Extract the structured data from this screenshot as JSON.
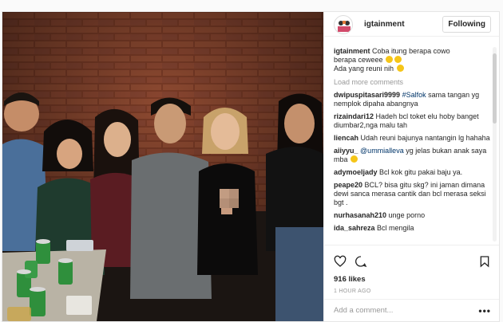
{
  "post": {
    "username": "igtainment",
    "follow_label": "Following",
    "caption": {
      "username": "igtainment",
      "line1": "Coba itung berapa cowo",
      "line2": "berapa ceweee",
      "line3": "Ada yang reuni nih"
    },
    "load_more_label": "Load more comments",
    "comments": [
      {
        "user": "dwipuspitasari9999",
        "hashtag": "#Salfok",
        "text": " sama tangan yg nemplok dipaha abangnya"
      },
      {
        "user": "rizaindari12",
        "text": "Hadeh bcl toket elu hoby banget diumbar2,nga malu tah"
      },
      {
        "user": "liencah",
        "text": "Udah reuni bajunya nantangin lg hahaha"
      },
      {
        "user": "aiiyyu_",
        "mention": "@ummialleva",
        "text": " yg jelas bukan anak saya mba"
      },
      {
        "user": "adymoeljady",
        "text": "Bcl kok gitu pakai baju ya."
      },
      {
        "user": "peape20",
        "text": "BCL? bisa gitu skg? ini jaman dimana dewi sanca merasa cantik dan bcl merasa seksi bgt ."
      },
      {
        "user": "nurhasanah210",
        "text": "unge porno"
      },
      {
        "user": "ida_sahreza",
        "text": "Bcl mengila"
      }
    ],
    "likes_text": "916 likes",
    "timestamp": "1 HOUR AGO",
    "comment_placeholder": "Add a comment...",
    "more_label": "•••"
  },
  "icons": {
    "like": "heart-icon",
    "comment": "comment-bubble-icon",
    "save": "bookmark-icon",
    "avatar": "igtainment-logo"
  },
  "colors": {
    "link": "#003569",
    "muted": "#999999",
    "text": "#262626",
    "border": "#efefef"
  }
}
